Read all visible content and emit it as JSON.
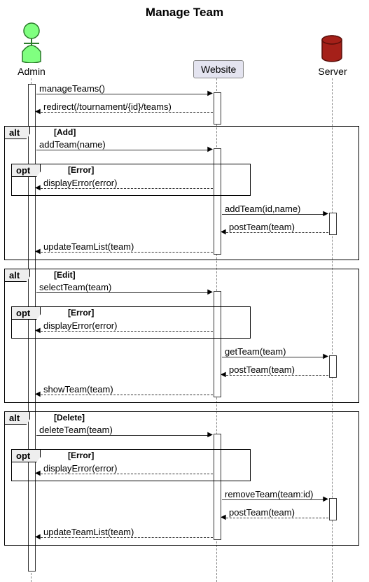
{
  "title": "Manage Team",
  "participants": {
    "admin": "Admin",
    "website": "Website",
    "server": "Server"
  },
  "messages": {
    "m1": "manageTeams()",
    "m2": "redirect(/tournament/{id}/teams)",
    "addBlock": {
      "tag": "alt",
      "cond": "[Add]",
      "m3": "addTeam(name)",
      "err": {
        "tag": "opt",
        "cond": "[Error]",
        "msg": "displayError(error)"
      },
      "m4": "addTeam(id,name)",
      "m5": "postTeam(team)",
      "m6": "updateTeamList(team)"
    },
    "editBlock": {
      "tag": "alt",
      "cond": "[Edit]",
      "m7": "selectTeam(team)",
      "err": {
        "tag": "opt",
        "cond": "[Error]",
        "msg": "displayError(error)"
      },
      "m8": "getTeam(team)",
      "m9": "postTeam(team)",
      "m10": "showTeam(team)"
    },
    "delBlock": {
      "tag": "alt",
      "cond": "[Delete]",
      "m11": "deleteTeam(team)",
      "err": {
        "tag": "opt",
        "cond": "[Error]",
        "msg": "displayError(error)"
      },
      "m12": "removeTeam(team:id)",
      "m13": "postTeam(team)",
      "m14": "updateTeamList(team)"
    }
  },
  "chart_data": {
    "type": "sequence-diagram",
    "participants": [
      "Admin",
      "Website",
      "Server"
    ],
    "interactions": [
      {
        "from": "Admin",
        "to": "Website",
        "label": "manageTeams()",
        "style": "solid"
      },
      {
        "from": "Website",
        "to": "Admin",
        "label": "redirect(/tournament/{id}/teams)",
        "style": "dashed"
      },
      {
        "frame": "alt",
        "cond": "[Add]",
        "children": [
          {
            "from": "Admin",
            "to": "Website",
            "label": "addTeam(name)",
            "style": "solid"
          },
          {
            "frame": "opt",
            "cond": "[Error]",
            "children": [
              {
                "from": "Website",
                "to": "Admin",
                "label": "displayError(error)",
                "style": "dashed"
              }
            ]
          },
          {
            "from": "Website",
            "to": "Server",
            "label": "addTeam(id,name)",
            "style": "solid"
          },
          {
            "from": "Server",
            "to": "Website",
            "label": "postTeam(team)",
            "style": "dashed"
          },
          {
            "from": "Website",
            "to": "Admin",
            "label": "updateTeamList(team)",
            "style": "dashed"
          }
        ]
      },
      {
        "frame": "alt",
        "cond": "[Edit]",
        "children": [
          {
            "from": "Admin",
            "to": "Website",
            "label": "selectTeam(team)",
            "style": "solid"
          },
          {
            "frame": "opt",
            "cond": "[Error]",
            "children": [
              {
                "from": "Website",
                "to": "Admin",
                "label": "displayError(error)",
                "style": "dashed"
              }
            ]
          },
          {
            "from": "Website",
            "to": "Server",
            "label": "getTeam(team)",
            "style": "solid"
          },
          {
            "from": "Server",
            "to": "Website",
            "label": "postTeam(team)",
            "style": "dashed"
          },
          {
            "from": "Website",
            "to": "Admin",
            "label": "showTeam(team)",
            "style": "dashed"
          }
        ]
      },
      {
        "frame": "alt",
        "cond": "[Delete]",
        "children": [
          {
            "from": "Admin",
            "to": "Website",
            "label": "deleteTeam(team)",
            "style": "solid"
          },
          {
            "frame": "opt",
            "cond": "[Error]",
            "children": [
              {
                "from": "Website",
                "to": "Admin",
                "label": "displayError(error)",
                "style": "dashed"
              }
            ]
          },
          {
            "from": "Website",
            "to": "Server",
            "label": "removeTeam(team:id)",
            "style": "solid"
          },
          {
            "from": "Server",
            "to": "Website",
            "label": "postTeam(team)",
            "style": "dashed"
          },
          {
            "from": "Website",
            "to": "Admin",
            "label": "updateTeamList(team)",
            "style": "dashed"
          }
        ]
      }
    ]
  }
}
